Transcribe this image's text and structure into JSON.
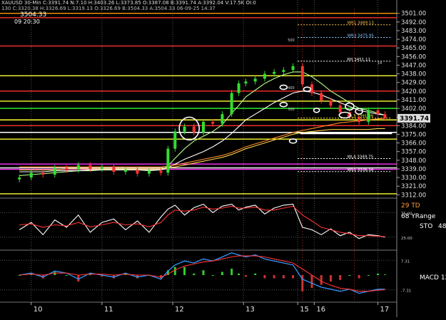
{
  "header": {
    "line1": "XAUUSD 30-Min  C:3391.74  N:7.10  H:3403.26  L:3373.85  O:3387.08  B:3391.74  A:3392.04  V:17.5K  OI:0",
    "line2": "130  C:3320.38  H:3326.69  L:3319.13  O:3326.69  B:3504.33  A:3504.33  06-09-25  14:37",
    "price": "3504.33",
    "time": "09 20:30"
  },
  "chart_data": {
    "type": "line",
    "price_axis": {
      "ylim": [
        3310,
        3506
      ],
      "ticks": [
        "3501.00",
        "3492.00",
        "3483.00",
        "3474.00",
        "3465.00",
        "3456.00",
        "3447.00",
        "3438.00",
        "3429.00",
        "3420.00",
        "3411.00",
        "3402.00",
        "3393.00",
        "3384.00",
        "3375.00",
        "3366.00",
        "3357.00",
        "3348.00",
        "3339.00",
        "3330.00",
        "3321.00",
        "3312.00"
      ],
      "last_price": "3391.74",
      "last_price_value": 3391.74
    },
    "x_axis": {
      "ticks": [
        "10",
        "11",
        "12",
        "13",
        "15",
        "16",
        "17"
      ],
      "tick_positions": [
        0.5,
        3.5,
        6.5,
        9.5,
        11.8,
        12.5,
        15.2
      ],
      "xlim": [
        -0.4,
        16.0
      ]
    },
    "price_series": {
      "candles_x": [
        0.0,
        0.5,
        1.0,
        1.5,
        2.0,
        2.5,
        3.0,
        3.5,
        4.0,
        4.5,
        5.0,
        5.5,
        6.0,
        6.3,
        6.6,
        7.0,
        7.4,
        7.8,
        8.2,
        8.6,
        9.0,
        9.3,
        9.6,
        10.0,
        10.4,
        10.8,
        11.2,
        11.6,
        12.0,
        12.4,
        12.8,
        13.2,
        13.6,
        14.0,
        14.4,
        14.8,
        15.2,
        15.5
      ],
      "close": [
        3330,
        3335,
        3333,
        3340,
        3338,
        3343,
        3339,
        3341,
        3336,
        3338,
        3334,
        3337,
        3335,
        3360,
        3378,
        3383,
        3377,
        3388,
        3386,
        3396,
        3418,
        3428,
        3430,
        3433,
        3438,
        3440,
        3442,
        3446,
        3427,
        3418,
        3410,
        3405,
        3398,
        3393,
        3388,
        3400,
        3396,
        3392
      ]
    },
    "moving_averages": [
      {
        "color": "#b8ff8c",
        "values": [
          3332,
          3333,
          3334,
          3335,
          3336,
          3337,
          3337,
          3338,
          3338,
          3338,
          3338,
          3337,
          3338,
          3342,
          3350,
          3360,
          3368,
          3373,
          3378,
          3385,
          3397,
          3405,
          3414,
          3421,
          3428,
          3433,
          3437,
          3440,
          3440,
          3435,
          3428,
          3420,
          3414,
          3408,
          3402,
          3400,
          3397,
          3395
        ]
      },
      {
        "color": "#ffffff",
        "values": [
          3336,
          3336,
          3336,
          3337,
          3337,
          3337,
          3338,
          3338,
          3338,
          3338,
          3338,
          3338,
          3338,
          3340,
          3344,
          3349,
          3353,
          3357,
          3362,
          3368,
          3376,
          3383,
          3390,
          3396,
          3402,
          3408,
          3413,
          3418,
          3420,
          3419,
          3416,
          3412,
          3408,
          3404,
          3400,
          3398,
          3396,
          3395
        ]
      },
      {
        "color": "#ffd24a",
        "values": [
          3338,
          3338,
          3338,
          3338,
          3339,
          3339,
          3339,
          3339,
          3339,
          3339,
          3339,
          3339,
          3339,
          3340,
          3341,
          3343,
          3345,
          3347,
          3349,
          3351,
          3354,
          3357,
          3360,
          3363,
          3366,
          3369,
          3372,
          3375,
          3377,
          3378,
          3379,
          3380,
          3380,
          3380,
          3380,
          3380,
          3381,
          3381
        ]
      },
      {
        "color": "#ff8c2a",
        "values": [
          3341,
          3341,
          3341,
          3341,
          3341,
          3341,
          3341,
          3341,
          3341,
          3341,
          3341,
          3341,
          3341,
          3342,
          3343,
          3345,
          3347,
          3349,
          3351,
          3353,
          3356,
          3359,
          3362,
          3365,
          3368,
          3371,
          3374,
          3377,
          3379,
          3381,
          3383,
          3385,
          3387,
          3388,
          3389,
          3390,
          3391,
          3392
        ]
      }
    ],
    "horizontal_levels": [
      {
        "price": 3501.0,
        "color": "#ff9a00"
      },
      {
        "price": 3496.5,
        "color": "#ff3030"
      },
      {
        "price": 3467.0,
        "color": "#ff3030"
      },
      {
        "price": 3436.0,
        "color": "#ffff33"
      },
      {
        "price": 3420.0,
        "color": "#ff3030"
      },
      {
        "price": 3409.5,
        "color": "#ffff33"
      },
      {
        "price": 3402.0,
        "color": "#33ff33"
      },
      {
        "price": 3390.0,
        "color": "#ffff33"
      },
      {
        "price": 3384.0,
        "color": "#ff3030"
      },
      {
        "price": 3377.0,
        "color": "#ffffff"
      },
      {
        "price": 3370.0,
        "color": "#ffff33"
      },
      {
        "price": 3344.0,
        "color": "#ff33ff"
      },
      {
        "price": 3340.0,
        "color": "#ffffff"
      },
      {
        "price": 3338.5,
        "color": "#ff33ff"
      },
      {
        "price": 3313.0,
        "color": "#ffff33"
      }
    ],
    "level_labels": [
      {
        "text": "WR1 3489.13",
        "price": 3489.13,
        "color": "#ffc84a"
      },
      {
        "text": "WR3 3475.95",
        "price": 3475.95,
        "color": "#8ccaff"
      },
      {
        "text": "RH 3451.11",
        "price": 3451.11,
        "color": "#ffffff"
      },
      {
        "text": "WL3 3391.89",
        "price": 3391.89,
        "color": "#ffff33"
      },
      {
        "text": "WL4 3349.75",
        "price": 3349.75,
        "color": "#ffffff"
      },
      {
        "text": "WS1 3336.16",
        "price": 3336.16,
        "color": "#ffffff"
      }
    ],
    "stochastic": {
      "label": "STO",
      "label_value": "48",
      "levels": [
        "75.00",
        "25.00"
      ],
      "ylim": [
        0,
        100
      ],
      "k": [
        40,
        55,
        30,
        60,
        45,
        70,
        35,
        55,
        62,
        40,
        58,
        35,
        66,
        82,
        90,
        70,
        85,
        92,
        75,
        88,
        92,
        80,
        86,
        90,
        72,
        84,
        90,
        92,
        45,
        40,
        30,
        42,
        28,
        35,
        22,
        30,
        28,
        25
      ],
      "d": [
        50,
        52,
        45,
        50,
        48,
        55,
        46,
        50,
        55,
        50,
        52,
        46,
        55,
        70,
        80,
        78,
        80,
        86,
        82,
        84,
        88,
        84,
        84,
        86,
        80,
        80,
        84,
        88,
        70,
        58,
        45,
        40,
        35,
        32,
        28,
        28,
        27,
        26
      ]
    },
    "macd": {
      "label": "MACD 12",
      "levels": [
        "7.31",
        "-7.31"
      ],
      "ylim": [
        -12,
        12
      ],
      "line": [
        0,
        1,
        -1,
        2,
        1,
        -2,
        1,
        0,
        -1,
        1,
        -1,
        0,
        -2,
        2,
        5,
        7,
        6,
        8,
        7,
        9,
        11,
        10,
        9,
        10,
        8,
        7,
        6,
        5,
        -2,
        -4,
        -6,
        -7,
        -8,
        -7,
        -9,
        -8,
        -7,
        -7
      ],
      "signal": [
        0,
        0.5,
        0,
        1,
        1,
        0,
        0.5,
        0.5,
        0,
        0.5,
        0,
        0,
        -1,
        0.5,
        2.5,
        4.5,
        5.5,
        6.5,
        7,
        8,
        9,
        9.5,
        9.5,
        9.5,
        9,
        8,
        7,
        6,
        3,
        0,
        -3,
        -5,
        -6.5,
        -7,
        -8,
        -8,
        -7.5,
        -7.2
      ]
    },
    "td_label": "29 TD",
    "yrange_label": "68 YRange",
    "small_labels": [
      "500",
      "400",
      "300",
      "14"
    ]
  }
}
